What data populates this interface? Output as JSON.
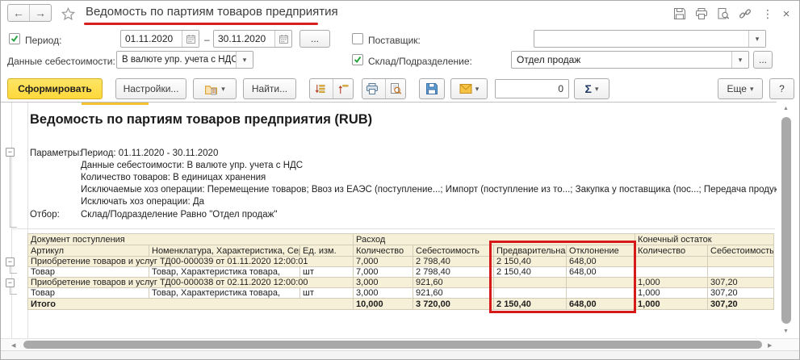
{
  "titlebar": {
    "title": "Ведомость по партиям товаров предприятия"
  },
  "filters": {
    "period_label": "Период:",
    "date_from": "01.11.2020",
    "date_to": "30.11.2020",
    "range_dash": "–",
    "period_more": "...",
    "supplier_label": "Поставщик:",
    "supplier_value": "",
    "cost_label": "Данные себестоимости:",
    "cost_value": "В валюте упр. учета с НДС",
    "warehouse_label": "Склад/Подразделение:",
    "warehouse_value": "Отдел продаж",
    "warehouse_more": "..."
  },
  "toolbar": {
    "generate_label": "Сформировать",
    "settings_label": "Настройки...",
    "find_label": "Найти...",
    "counter_value": "0",
    "sigma_label": "Σ",
    "more_label": "Еще",
    "help_label": "?"
  },
  "report": {
    "title": "Ведомость по партиям товаров предприятия (RUB)",
    "params_label": "Параметры:",
    "params": [
      "Период: 01.11.2020 - 30.11.2020",
      "Данные себестоимости: В валюте упр. учета с НДС",
      "Количество товаров: В единицах хранения",
      "Исключаемые хоз операции: Перемещение товаров; Ввоз из ЕАЭС (поступление...; Импорт (поступление из то...; Закупка у поставщика (пос...; Передача продукции",
      "Исключать хоз операции: Да"
    ],
    "filter_label": "Отбор:",
    "filter_value": "Склад/Подразделение Равно \"Отдел продаж\"",
    "table": {
      "header_groups": [
        {
          "label": "Документ поступления",
          "span": 3
        },
        {
          "label": "Расход",
          "span": 4
        },
        {
          "label": "Конечный остаток",
          "span": 2
        }
      ],
      "columns": [
        "Артикул",
        "Номенклатура, Характеристика, Серия",
        "Ед. изм.",
        "Количество",
        "Себестоимость",
        "Предварительная",
        "Отклонение",
        "Количество",
        "Себестоимость"
      ],
      "rows": [
        {
          "type": "group",
          "cells": [
            "Приобретение товаров и услуг ТД00-000039 от 01.11.2020 12:00:01",
            "",
            "",
            "7,000",
            "2 798,40",
            "2 150,40",
            "648,00",
            "",
            ""
          ]
        },
        {
          "type": "detail",
          "cells": [
            "Товар",
            "Товар, Характеристика товара,",
            "шт",
            "7,000",
            "2 798,40",
            "2 150,40",
            "648,00",
            "",
            ""
          ]
        },
        {
          "type": "group",
          "cells": [
            "Приобретение товаров и услуг ТД00-000038 от 02.11.2020 12:00:00",
            "",
            "",
            "3,000",
            "921,60",
            "",
            "",
            "1,000",
            "307,20"
          ]
        },
        {
          "type": "detail",
          "cells": [
            "Товар",
            "Товар, Характеристика товара,",
            "шт",
            "3,000",
            "921,60",
            "",
            "",
            "1,000",
            "307,20"
          ]
        },
        {
          "type": "total",
          "cells": [
            "Итого",
            "",
            "",
            "10,000",
            "3 720,00",
            "2 150,40",
            "648,00",
            "1,000",
            "307,20"
          ]
        }
      ]
    }
  },
  "colors": {
    "annotation_red": "#D81E1E",
    "table_cream": "#F7F0D8",
    "accent_yellow": "#FFD83B",
    "check_green": "#21A038"
  }
}
